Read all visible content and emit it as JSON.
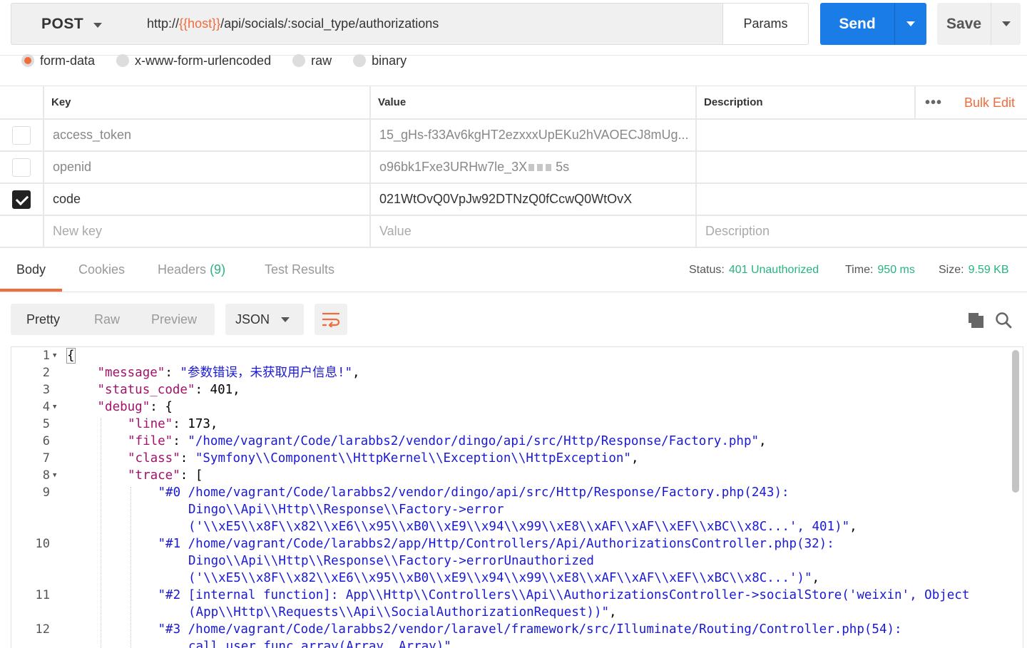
{
  "request": {
    "method": "POST",
    "url_prefix": "http://",
    "url_var": "{{host}}",
    "url_path": "/api/socials/:social_type/authorizations",
    "params_label": "Params",
    "send_label": "Send",
    "save_label": "Save"
  },
  "body_types": [
    {
      "label": "form-data",
      "selected": true
    },
    {
      "label": "x-www-form-urlencoded",
      "selected": false
    },
    {
      "label": "raw",
      "selected": false
    },
    {
      "label": "binary",
      "selected": false
    }
  ],
  "params_table": {
    "headers": {
      "key": "Key",
      "value": "Value",
      "description": "Description"
    },
    "bulk_edit_label": "Bulk Edit",
    "more_label": "•••",
    "rows": [
      {
        "checked": false,
        "key": "access_token",
        "value": "15_gHs-f33Av6kgHT2ezxxxUpEKu2hVAOECJ8mUg...",
        "description": ""
      },
      {
        "checked": false,
        "key": "openid",
        "value": "o96bk1Fxe3URHw7le_3X",
        "value_tail": "5s",
        "description": ""
      },
      {
        "checked": true,
        "key": "code",
        "value": "021WtOvQ0VpJw92DTNzQ0fCcwQ0WtOvX",
        "description": ""
      }
    ],
    "new_row": {
      "key_placeholder": "New key",
      "value_placeholder": "Value",
      "description_placeholder": "Description"
    }
  },
  "response": {
    "tabs": [
      {
        "label": "Body",
        "active": true
      },
      {
        "label": "Cookies",
        "active": false
      },
      {
        "label": "Headers",
        "count": "(9)",
        "active": false
      },
      {
        "label": "Test Results",
        "active": false
      }
    ],
    "status_label": "Status:",
    "status_value": "401 Unauthorized",
    "time_label": "Time:",
    "time_value": "950 ms",
    "size_label": "Size:",
    "size_value": "9.59 KB",
    "view_modes": [
      "Pretty",
      "Raw",
      "Preview"
    ],
    "active_view": "Pretty",
    "format": "JSON"
  },
  "colors": {
    "accent": "#f26b3a",
    "send_blue": "#1a7ce6",
    "success_green": "#26b47f",
    "json_key": "#a1126a",
    "json_string": "#1a1ad2"
  },
  "code_lines": [
    {
      "ln": "1",
      "fold": true,
      "indent": 0,
      "html": "<span class=\"n cursor-brace\">{</span>"
    },
    {
      "ln": "2",
      "indent": 1,
      "html": "<span class=\"k\">\"message\"</span>: <span class=\"s\">\"参数错误，未获取用户信息!\"</span>,"
    },
    {
      "ln": "3",
      "indent": 1,
      "html": "<span class=\"k\">\"status_code\"</span>: <span class=\"n\">401</span>,"
    },
    {
      "ln": "4",
      "fold": true,
      "indent": 1,
      "html": "<span class=\"k\">\"debug\"</span>: {"
    },
    {
      "ln": "5",
      "indent": 2,
      "html": "<span class=\"k\">\"line\"</span>: <span class=\"n\">173</span>,"
    },
    {
      "ln": "6",
      "indent": 2,
      "html": "<span class=\"k\">\"file\"</span>: <span class=\"s\">\"/home/vagrant/Code/larabbs2/vendor/dingo/api/src/Http/Response/Factory.php\"</span>,"
    },
    {
      "ln": "7",
      "indent": 2,
      "html": "<span class=\"k\">\"class\"</span>: <span class=\"s\">\"Symfony\\\\Component\\\\HttpKernel\\\\Exception\\\\HttpException\"</span>,"
    },
    {
      "ln": "8",
      "fold": true,
      "indent": 2,
      "html": "<span class=\"k\">\"trace\"</span>: ["
    },
    {
      "ln": "9",
      "indent": 3,
      "html": "<span class=\"s\">\"#0 /home/vagrant/Code/larabbs2/vendor/dingo/api/src/Http/Response/Factory.php(243):</span>"
    },
    {
      "ln": "",
      "indent": 4,
      "html": "<span class=\"s\">Dingo\\\\Api\\\\Http\\\\Response\\\\Factory-&gt;error</span>"
    },
    {
      "ln": "",
      "indent": 4,
      "html": "<span class=\"s\">('\\\\xE5\\\\x8F\\\\x82\\\\xE6\\\\x95\\\\xB0\\\\xE9\\\\x94\\\\x99\\\\xE8\\\\xAF\\\\xAF\\\\xEF\\\\xBC\\\\x8C...', 401)\"</span>,"
    },
    {
      "ln": "10",
      "indent": 3,
      "html": "<span class=\"s\">\"#1 /home/vagrant/Code/larabbs2/app/Http/Controllers/Api/AuthorizationsController.php(32):</span>"
    },
    {
      "ln": "",
      "indent": 4,
      "html": "<span class=\"s\">Dingo\\\\Api\\\\Http\\\\Response\\\\Factory-&gt;errorUnauthorized</span>"
    },
    {
      "ln": "",
      "indent": 4,
      "html": "<span class=\"s\">('\\\\xE5\\\\x8F\\\\x82\\\\xE6\\\\x95\\\\xB0\\\\xE9\\\\x94\\\\x99\\\\xE8\\\\xAF\\\\xAF\\\\xEF\\\\xBC\\\\x8C...')\"</span>,"
    },
    {
      "ln": "11",
      "indent": 3,
      "html": "<span class=\"s\">\"#2 [internal function]: App\\\\Http\\\\Controllers\\\\Api\\\\AuthorizationsController-&gt;socialStore('weixin', Object</span>"
    },
    {
      "ln": "",
      "indent": 4,
      "html": "<span class=\"s\">(App\\\\Http\\\\Requests\\\\Api\\\\SocialAuthorizationRequest))\"</span>,"
    },
    {
      "ln": "12",
      "indent": 3,
      "html": "<span class=\"s\">\"#3 /home/vagrant/Code/larabbs2/vendor/laravel/framework/src/Illuminate/Routing/Controller.php(54):</span>"
    },
    {
      "ln": "",
      "indent": 4,
      "html": "<span class=\"s\">call_user_func_array(Array, Array)\"</span>,"
    }
  ]
}
